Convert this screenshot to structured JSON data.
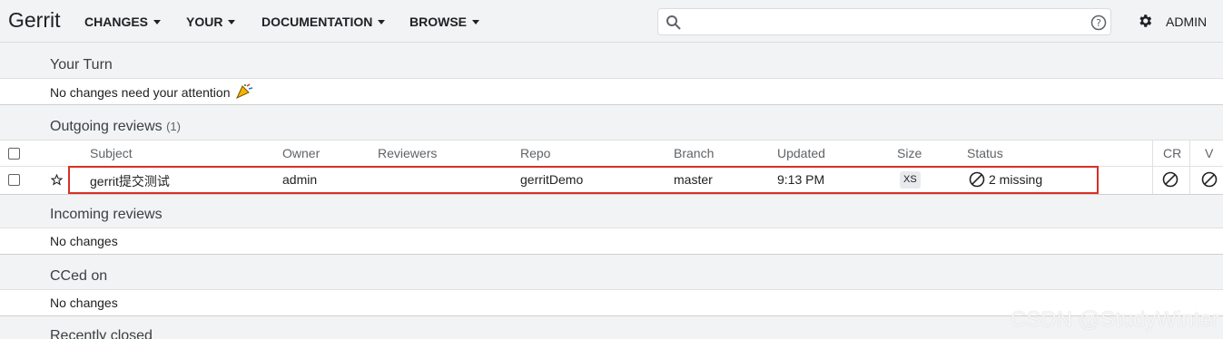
{
  "header": {
    "logo": "Gerrit",
    "nav": [
      {
        "label": "CHANGES"
      },
      {
        "label": "YOUR"
      },
      {
        "label": "DOCUMENTATION"
      },
      {
        "label": "BROWSE"
      }
    ],
    "search_value": "",
    "user": "ADMIN"
  },
  "sections": {
    "your_turn": {
      "title": "Your Turn",
      "message": "No changes need your attention"
    },
    "outgoing": {
      "title": "Outgoing reviews",
      "count": "(1)"
    },
    "incoming": {
      "title": "Incoming reviews",
      "message": "No changes"
    },
    "cced": {
      "title": "CCed on",
      "message": "No changes"
    },
    "recent": {
      "title": "Recently closed"
    }
  },
  "table": {
    "columns": [
      "Subject",
      "Owner",
      "Reviewers",
      "Repo",
      "Branch",
      "Updated",
      "Size",
      "Status",
      "CR",
      "V"
    ],
    "row": {
      "subject": "gerrit提交测试",
      "owner": "admin",
      "reviewers": "",
      "repo": "gerritDemo",
      "branch": "master",
      "updated": "9:13 PM",
      "size": "XS",
      "status": "2 missing"
    }
  },
  "watermark": "CSDN @StudyWinter",
  "colors": {
    "highlight": "#d93025",
    "background": "#f1f3f4"
  }
}
